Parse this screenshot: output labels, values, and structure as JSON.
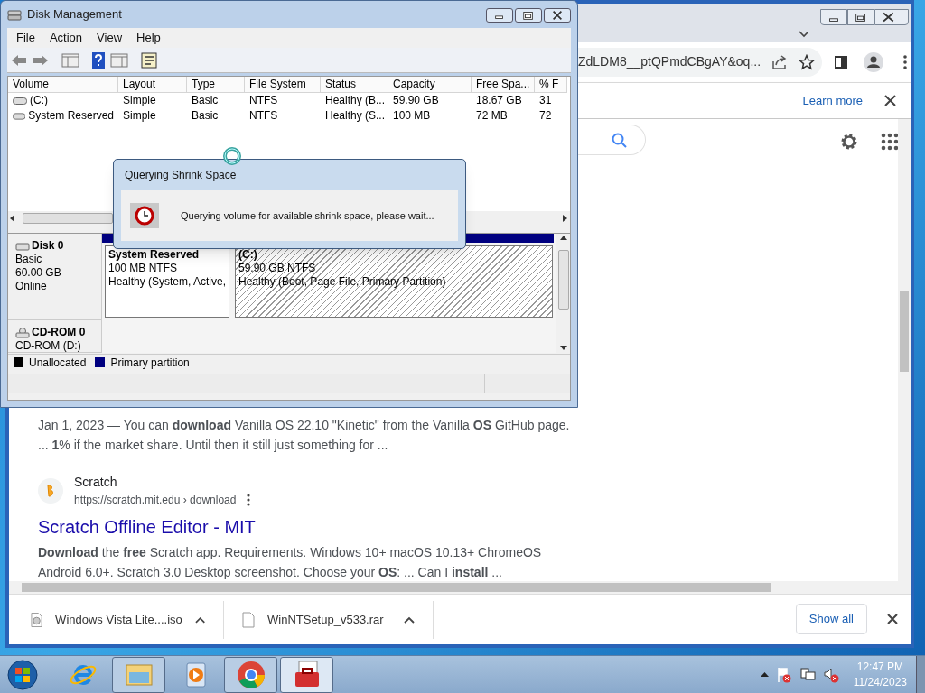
{
  "disk_management": {
    "title": "Disk Management",
    "menu": [
      "File",
      "Action",
      "View",
      "Help"
    ],
    "columns": [
      "Volume",
      "Layout",
      "Type",
      "File System",
      "Status",
      "Capacity",
      "Free Spa...",
      "% F"
    ],
    "volumes": [
      {
        "cells": [
          "(C:)",
          "Simple",
          "Basic",
          "NTFS",
          "Healthy (B...",
          "59.90 GB",
          "18.67 GB",
          "31"
        ]
      },
      {
        "cells": [
          "System Reserved",
          "Simple",
          "Basic",
          "NTFS",
          "Healthy (S...",
          "100 MB",
          "72 MB",
          "72"
        ]
      }
    ],
    "disks": [
      {
        "kind": "disk",
        "name": "Disk 0",
        "lines": [
          "Basic",
          "60.00 GB",
          "Online"
        ],
        "partitions": [
          {
            "name": "System Reserved",
            "size": "100 MB NTFS",
            "status": "Healthy (System, Active,",
            "hatched": false
          },
          {
            "name": "(C:)",
            "size": "59.90 GB NTFS",
            "status": "Healthy (Boot, Page File, Primary Partition)",
            "hatched": true
          }
        ]
      },
      {
        "kind": "cdrom",
        "name": "CD-ROM 0",
        "lines": [
          "CD-ROM (D:)"
        ]
      }
    ],
    "legend": [
      {
        "label": "Unallocated",
        "color": "#000000"
      },
      {
        "label": "Primary partition",
        "color": "#000080"
      }
    ]
  },
  "dialog": {
    "title": "Querying Shrink Space",
    "message": "Querying volume for available shrink space, please wait..."
  },
  "browser": {
    "url": "ZdLDM8__ptQPmdCBgAY&oq...",
    "infobar_link": "Learn more",
    "results": [
      {
        "snippet": "Jan 1, 2023 — You can **download** Vanilla OS 22.10 \"Kinetic\" from the Vanilla **OS** GitHub page. ... **1**% if the market share. Until then it still just something for ..."
      },
      {
        "source": "Scratch",
        "url": "https://scratch.mit.edu › download",
        "title": "Scratch Offline Editor - MIT",
        "snippet": "**Download** the **free** Scratch app. Requirements. Windows 10+ macOS 10.13+ ChromeOS Android 6.0+. Scratch 3.0 Desktop screenshot. Choose your **OS**: ... Can I **install** ..."
      }
    ],
    "downloads": [
      {
        "kind": "disc",
        "name": "Windows Vista Lite....iso"
      },
      {
        "kind": "file",
        "name": "WinNTSetup_v533.rar"
      }
    ],
    "show_all": "Show all"
  },
  "taskbar": {
    "apps": [
      {
        "kind": "ie",
        "open": false,
        "selected": false
      },
      {
        "kind": "explorer",
        "open": true,
        "selected": false
      },
      {
        "kind": "media",
        "open": false,
        "selected": false
      },
      {
        "kind": "chrome",
        "open": true,
        "selected": false
      },
      {
        "kind": "toolbox",
        "open": true,
        "selected": true
      }
    ],
    "time": "12:47 PM",
    "date": "11/24/2023"
  }
}
